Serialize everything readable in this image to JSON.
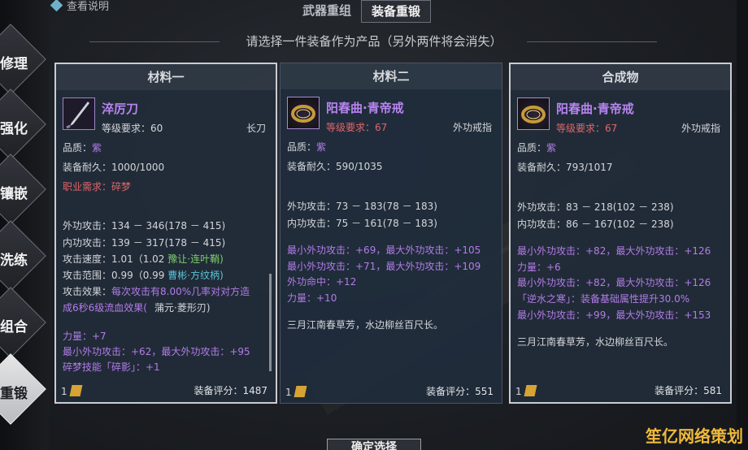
{
  "help_label": "查看说明",
  "top_tabs": [
    "武器重组",
    "装备重锻"
  ],
  "subtitle": "请选择一件装备作为产品（另外两件将会消失）",
  "side_tabs": [
    "修理",
    "强化",
    "镶嵌",
    "洗练",
    "组合",
    "重锻"
  ],
  "panels": [
    {
      "title": "材料一",
      "item_name": "淬厉刀",
      "level_req": "等级要求：60",
      "slot": "长刀",
      "quality_label": "品质：",
      "quality": "紫",
      "durability": "装备耐久：1000/1000",
      "class_req": "职业需求：碎梦",
      "stats": [
        "外功攻击：134 － 346(178 － 415)",
        "内功攻击：139 － 317(178 － 415)",
        "攻击速度：1.01（1.02",
        "攻击范围：0.99（0.99",
        "攻击效果：",
        "成6秒6级流血效果(",
        "蒲元·菱形刃)"
      ],
      "speed_tag": "豫让·连叶鞘)",
      "range_tag": "曹彬·方纹柄)",
      "effect_text": "每次攻击有8.00%几率对对方造",
      "effect_tag": "蒲元·菱形刃",
      "bonuses": [
        "力量：+7",
        "最小外功攻击：+62，最大外功攻击：+95",
        "碎梦技能「碎影」：+1"
      ],
      "count": "1",
      "score": "装备评分：1487"
    },
    {
      "title": "材料二",
      "item_name": "阳春曲·青帝戒",
      "level_req": "等级要求：67",
      "slot": "外功戒指",
      "quality_label": "品质：",
      "quality": "紫",
      "durability": "装备耐久：590/1035",
      "stats": [
        "外功攻击：73 － 183(78 － 183)",
        "内功攻击：75 － 161(78 － 183)"
      ],
      "bonuses": [
        "最小外功攻击：+69，最大外功攻击：+105",
        "最小外功攻击：+71，最大外功攻击：+109",
        "外功命中：+12",
        "力量：+10"
      ],
      "flavor": "三月江南春草芳，水边柳丝百尺长。",
      "count": "1",
      "score": "装备评分：551"
    },
    {
      "title": "合成物",
      "item_name": "阳春曲·青帝戒",
      "level_req": "等级要求：67",
      "slot": "外功戒指",
      "quality_label": "品质：",
      "quality": "紫",
      "durability": "装备耐久：793/1017",
      "stats": [
        "外功攻击：83 － 218(102 － 238)",
        "内功攻击：86 － 167(102 － 238)"
      ],
      "bonuses": [
        "最小外功攻击：+82，最大外功攻击：+126",
        "力量：+6",
        "最小外功攻击：+82，最大外功攻击：+126",
        "「逆水之寒」：装备基础属性提升30.0%",
        "最小外功攻击：+99，最大外功攻击：+153"
      ],
      "flavor": "三月江南春草芳，水边柳丝百尺长。",
      "count": "1",
      "score": "装备评分：581"
    }
  ],
  "confirm_label": "确定选择",
  "watermark": "笙亿网络策划"
}
